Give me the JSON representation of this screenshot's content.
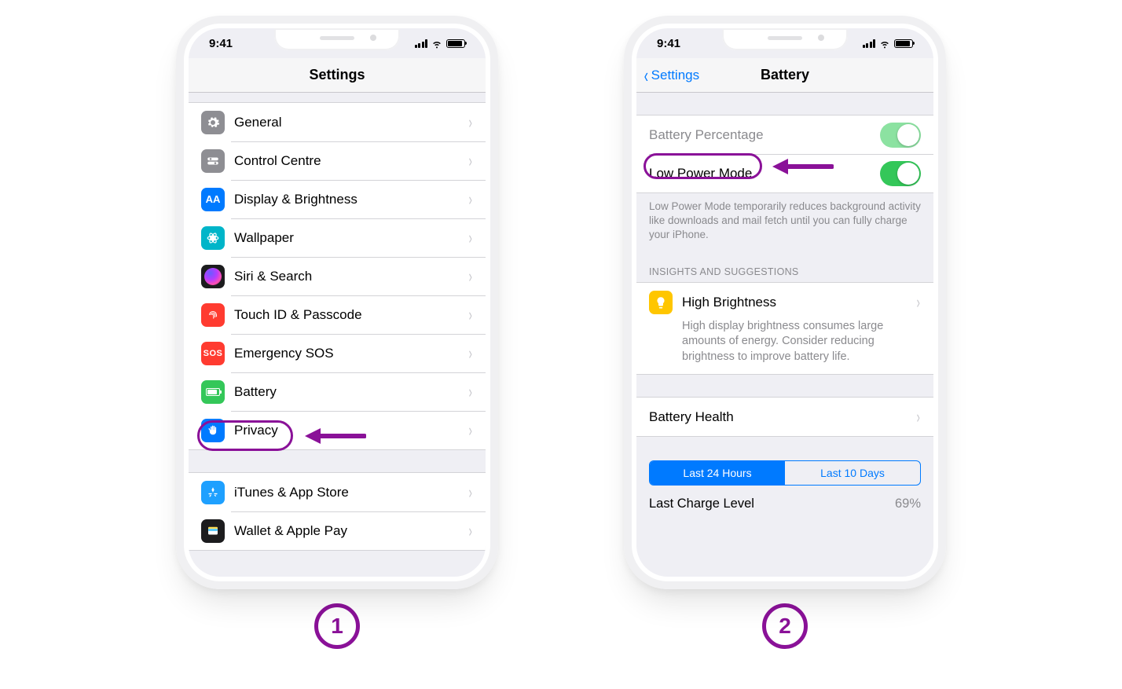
{
  "status_time": "9:41",
  "step1_label": "1",
  "step2_label": "2",
  "annot": {
    "color": "#8a1198"
  },
  "phone1": {
    "title": "Settings",
    "groups": [
      {
        "items": [
          {
            "id": "general",
            "label": "General"
          },
          {
            "id": "control-centre",
            "label": "Control Centre"
          },
          {
            "id": "display",
            "label": "Display & Brightness"
          },
          {
            "id": "wallpaper",
            "label": "Wallpaper"
          },
          {
            "id": "siri",
            "label": "Siri & Search"
          },
          {
            "id": "touchid",
            "label": "Touch ID & Passcode"
          },
          {
            "id": "sos",
            "label": "Emergency SOS"
          },
          {
            "id": "battery",
            "label": "Battery"
          },
          {
            "id": "privacy",
            "label": "Privacy"
          }
        ]
      },
      {
        "items": [
          {
            "id": "itunes",
            "label": "iTunes & App Store"
          },
          {
            "id": "wallet",
            "label": "Wallet & Apple Pay"
          }
        ]
      }
    ]
  },
  "phone2": {
    "back_label": "Settings",
    "title": "Battery",
    "toggles": {
      "percentage_label": "Battery Percentage",
      "percentage_on": true,
      "lowpower_label": "Low Power Mode",
      "lowpower_on": true
    },
    "lowpower_note": "Low Power Mode temporarily reduces background activity like downloads and mail fetch until you can fully charge your iPhone.",
    "insights_header": "INSIGHTS AND SUGGESTIONS",
    "insight": {
      "title": "High Brightness",
      "body": "High display brightness consumes large amounts of energy. Consider reducing brightness to improve battery life."
    },
    "battery_health_label": "Battery Health",
    "segmented": {
      "tab1": "Last 24 Hours",
      "tab2": "Last 10 Days",
      "active": 0
    },
    "charge": {
      "label": "Last Charge Level",
      "value": "69%"
    }
  }
}
